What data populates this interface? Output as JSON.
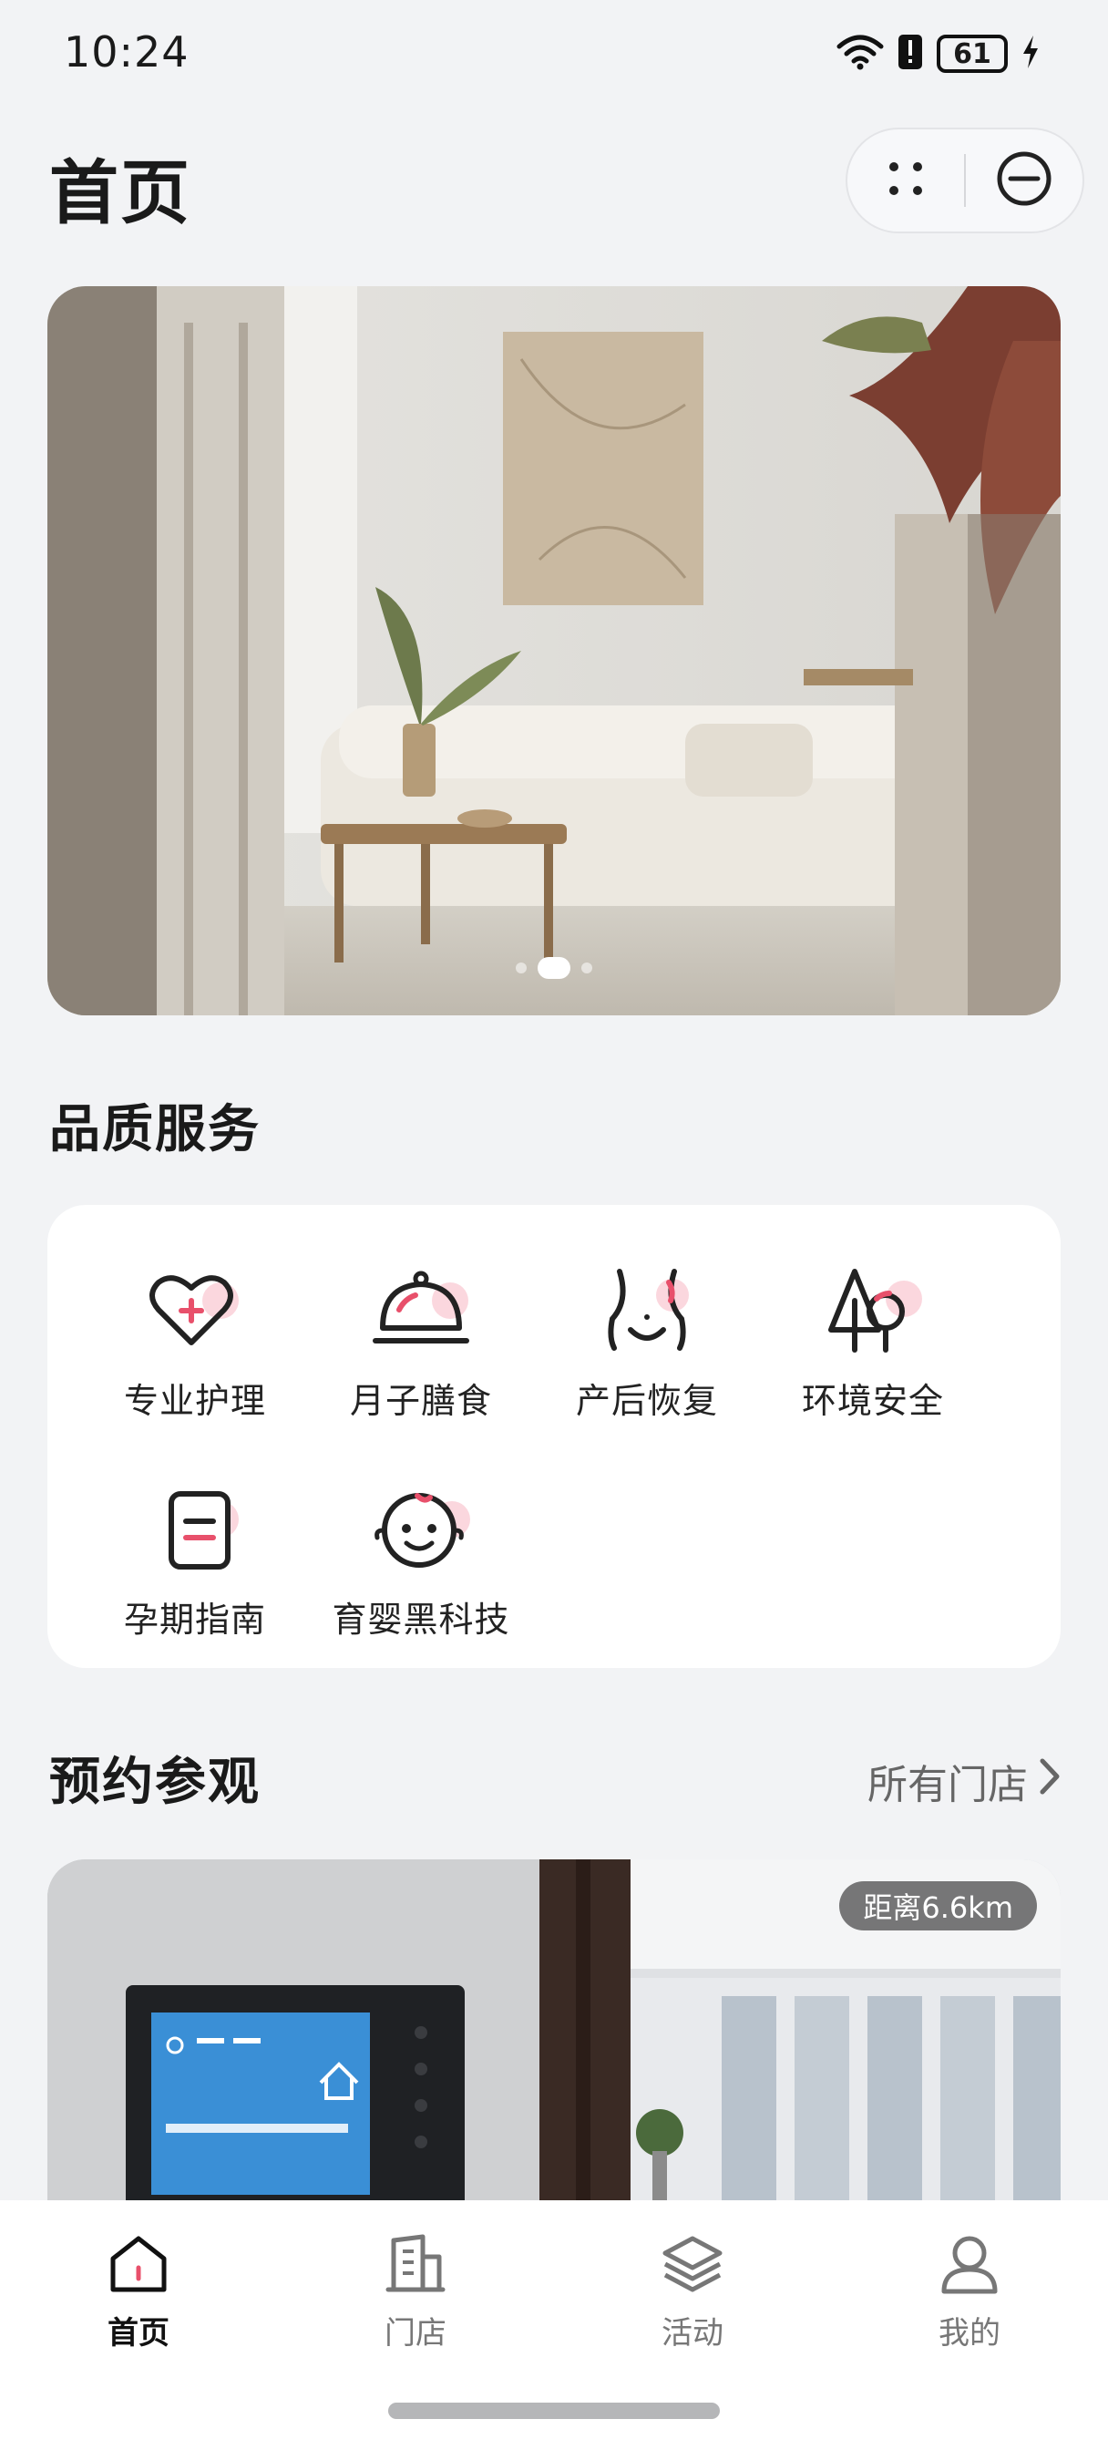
{
  "status_bar": {
    "time": "10:24",
    "battery": "61",
    "icons": [
      "wifi-icon",
      "alert-icon",
      "battery-icon",
      "charging-icon"
    ]
  },
  "header": {
    "title": "首页",
    "capsule_icons": [
      "more-dots-icon",
      "close-circle-icon"
    ]
  },
  "banner": {
    "image": "living-room-photo",
    "page_count": 3,
    "active_index": 1
  },
  "services": {
    "title": "品质服务",
    "items": [
      {
        "label": "专业护理",
        "icon": "heart-plus-icon"
      },
      {
        "label": "月子膳食",
        "icon": "cloche-icon"
      },
      {
        "label": "产后恢复",
        "icon": "body-icon"
      },
      {
        "label": "环境安全",
        "icon": "trees-icon"
      },
      {
        "label": "孕期指南",
        "icon": "document-icon"
      },
      {
        "label": "育婴黑科技",
        "icon": "baby-face-icon"
      }
    ]
  },
  "booking": {
    "title": "预约参观",
    "all_stores": "所有门店",
    "store_card": {
      "distance": "距离6.6km",
      "image": "store-interior-photo"
    }
  },
  "tab_bar": {
    "tabs": [
      {
        "label": "首页",
        "icon": "home-icon",
        "active": true
      },
      {
        "label": "门店",
        "icon": "building-icon",
        "active": false
      },
      {
        "label": "活动",
        "icon": "layers-icon",
        "active": false
      },
      {
        "label": "我的",
        "icon": "user-icon",
        "active": false
      }
    ]
  },
  "colors": {
    "accent": "#e8506b",
    "accent_soft": "#fbd7de",
    "background": "#f2f3f5",
    "card": "#ffffff",
    "text_primary": "#1a1a1a",
    "text_secondary": "#666666"
  }
}
